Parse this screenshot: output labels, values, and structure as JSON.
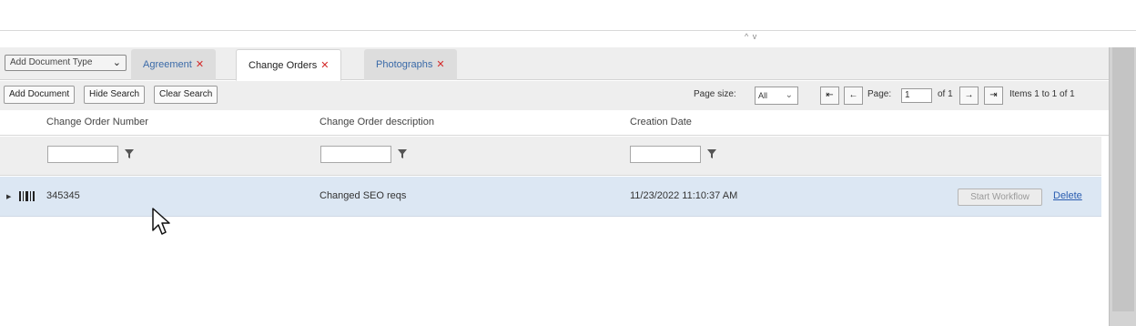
{
  "collapse_toggle": "^ v",
  "tabstrip": {
    "doc_type_select": "Add Document Type",
    "tabs": [
      {
        "label": "Agreement",
        "active": false
      },
      {
        "label": "Change Orders",
        "active": true
      },
      {
        "label": "Photographs",
        "active": false
      }
    ]
  },
  "toolbar": {
    "add_document": "Add Document",
    "hide_search": "Hide Search",
    "clear_search": "Clear Search",
    "page_size_label": "Page size:",
    "page_size_value": "All",
    "page_label": "Page:",
    "page_value": "1",
    "page_total": "of 1",
    "items_text": "Items 1 to 1 of 1"
  },
  "table": {
    "columns": [
      "Change Order Number",
      "Change Order description",
      "Creation Date"
    ],
    "rows": [
      {
        "number": "345345",
        "description": "Changed SEO reqs",
        "created": "11/23/2022 11:10:37 AM"
      }
    ],
    "row_actions": {
      "start_workflow": "Start Workflow",
      "delete": "Delete"
    }
  },
  "colors": {
    "accent_link": "#2a5db0",
    "close_x": "#d42a2a",
    "row_selected": "#dce7f3"
  }
}
